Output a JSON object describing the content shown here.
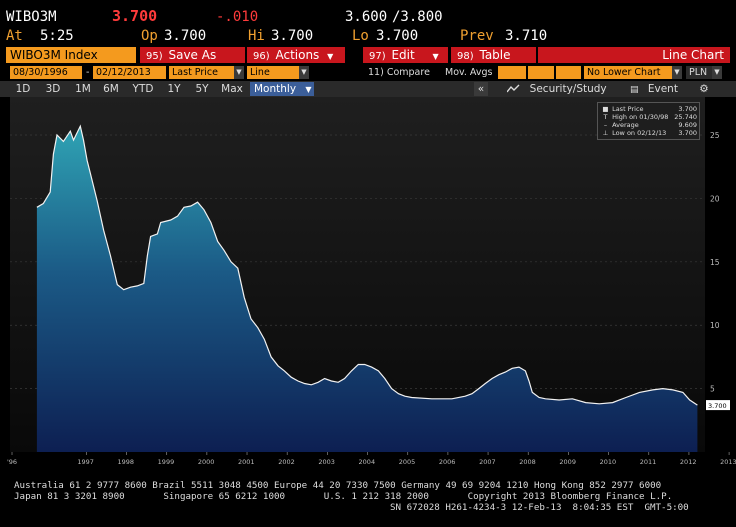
{
  "quote": {
    "ticker": "WIBO3M",
    "last": "3.700",
    "change": "-.010",
    "bid": "3.600",
    "ask": "/3.800",
    "time_label": "At",
    "time": "5:25",
    "open_label": "Op",
    "open": "3.700",
    "high_label": "Hi",
    "high": "3.700",
    "low_label": "Lo",
    "low": "3.700",
    "prev_label": "Prev",
    "prev": "3.710"
  },
  "menu": {
    "security": "WIBO3M Index",
    "save": {
      "num": "95)",
      "label": "Save As"
    },
    "actions": {
      "num": "96)",
      "label": "Actions"
    },
    "edit": {
      "num": "97)",
      "label": "Edit"
    },
    "table": {
      "num": "98)",
      "label": "Table"
    },
    "chart_type": "Line Chart"
  },
  "params": {
    "start_date": "08/30/1996",
    "sep": "-",
    "end_date": "02/12/2013",
    "field": "Last Price",
    "style": "Line",
    "compare": "11) Compare",
    "mov_avgs": "Mov. Avgs",
    "lower_chart": "No Lower Chart",
    "currency": "PLN"
  },
  "toolbar": {
    "periods": [
      "1D",
      "3D",
      "1M",
      "6M",
      "YTD",
      "1Y",
      "5Y",
      "Max"
    ],
    "frequency": "Monthly",
    "security_study": "Security/Study",
    "event": "Event",
    "back": "«"
  },
  "legend": {
    "rows": [
      {
        "label": "Last Price",
        "value": "3.700",
        "icon": "square"
      },
      {
        "label": "High on 01/30/98",
        "value": "25.740",
        "icon": "T"
      },
      {
        "label": "Average",
        "value": "9.609",
        "icon": "dash"
      },
      {
        "label": "Low on 02/12/13",
        "value": "3.700",
        "icon": "L"
      }
    ]
  },
  "chart_data": {
    "type": "area",
    "title": "",
    "xlabel": "",
    "ylabel": "",
    "ylim": [
      0,
      28
    ],
    "x_tick_labels": [
      "'96",
      "1997",
      "1998",
      "1999",
      "2000",
      "2001",
      "2002",
      "2003",
      "2004",
      "2005",
      "2006",
      "2007",
      "2008",
      "2009",
      "2010",
      "2011",
      "2012",
      "2013"
    ],
    "y_ticks": [
      5,
      10,
      15,
      20,
      25
    ],
    "last_value_label": "3.700",
    "series": [
      {
        "points": [
          [
            1996.67,
            19.3
          ],
          [
            1996.83,
            19.6
          ],
          [
            1997.0,
            20.5
          ],
          [
            1997.08,
            23.5
          ],
          [
            1997.17,
            25.0
          ],
          [
            1997.33,
            24.5
          ],
          [
            1997.5,
            25.3
          ],
          [
            1997.58,
            24.6
          ],
          [
            1997.75,
            25.7
          ],
          [
            1997.83,
            24.6
          ],
          [
            1997.92,
            23.0
          ],
          [
            1998.0,
            22.0
          ],
          [
            1998.17,
            19.8
          ],
          [
            1998.33,
            17.5
          ],
          [
            1998.5,
            15.5
          ],
          [
            1998.67,
            13.2
          ],
          [
            1998.83,
            12.8
          ],
          [
            1999.0,
            13.0
          ],
          [
            1999.17,
            13.1
          ],
          [
            1999.33,
            13.3
          ],
          [
            1999.42,
            15.5
          ],
          [
            1999.5,
            17.0
          ],
          [
            1999.67,
            17.2
          ],
          [
            1999.75,
            18.1
          ],
          [
            2000.0,
            18.3
          ],
          [
            2000.17,
            18.6
          ],
          [
            2000.33,
            19.3
          ],
          [
            2000.5,
            19.4
          ],
          [
            2000.67,
            19.7
          ],
          [
            2000.83,
            19.1
          ],
          [
            2001.0,
            18.1
          ],
          [
            2001.17,
            16.6
          ],
          [
            2001.33,
            15.9
          ],
          [
            2001.5,
            15.0
          ],
          [
            2001.67,
            14.5
          ],
          [
            2001.83,
            12.2
          ],
          [
            2002.0,
            10.5
          ],
          [
            2002.17,
            9.8
          ],
          [
            2002.33,
            8.9
          ],
          [
            2002.5,
            7.5
          ],
          [
            2002.67,
            6.8
          ],
          [
            2002.83,
            6.4
          ],
          [
            2003.0,
            5.9
          ],
          [
            2003.17,
            5.6
          ],
          [
            2003.33,
            5.4
          ],
          [
            2003.5,
            5.3
          ],
          [
            2003.67,
            5.5
          ],
          [
            2003.83,
            5.8
          ],
          [
            2004.0,
            5.6
          ],
          [
            2004.17,
            5.5
          ],
          [
            2004.33,
            5.8
          ],
          [
            2004.5,
            6.4
          ],
          [
            2004.67,
            6.9
          ],
          [
            2004.83,
            6.9
          ],
          [
            2005.0,
            6.7
          ],
          [
            2005.17,
            6.4
          ],
          [
            2005.33,
            5.8
          ],
          [
            2005.5,
            5.0
          ],
          [
            2005.67,
            4.6
          ],
          [
            2005.83,
            4.4
          ],
          [
            2006.0,
            4.3
          ],
          [
            2006.5,
            4.2
          ],
          [
            2007.0,
            4.2
          ],
          [
            2007.33,
            4.4
          ],
          [
            2007.5,
            4.6
          ],
          [
            2007.67,
            5.0
          ],
          [
            2007.83,
            5.4
          ],
          [
            2008.0,
            5.8
          ],
          [
            2008.17,
            6.1
          ],
          [
            2008.33,
            6.3
          ],
          [
            2008.5,
            6.6
          ],
          [
            2008.67,
            6.7
          ],
          [
            2008.83,
            6.4
          ],
          [
            2008.92,
            5.6
          ],
          [
            2009.0,
            4.7
          ],
          [
            2009.17,
            4.3
          ],
          [
            2009.33,
            4.2
          ],
          [
            2009.67,
            4.1
          ],
          [
            2010.0,
            4.2
          ],
          [
            2010.33,
            3.9
          ],
          [
            2010.67,
            3.8
          ],
          [
            2011.0,
            3.9
          ],
          [
            2011.33,
            4.3
          ],
          [
            2011.67,
            4.7
          ],
          [
            2012.0,
            4.9
          ],
          [
            2012.25,
            5.0
          ],
          [
            2012.5,
            4.9
          ],
          [
            2012.75,
            4.7
          ],
          [
            2012.92,
            4.1
          ],
          [
            2013.11,
            3.7
          ]
        ]
      }
    ]
  },
  "footer": {
    "line1": "Australia 61 2 9777 8600 Brazil 5511 3048 4500 Europe 44 20 7330 7500 Germany 49 69 9204 1210 Hong Kong 852 2977 6000",
    "line2": "Japan 81 3 3201 8900       Singapore 65 6212 1000       U.S. 1 212 318 2000       Copyright 2013 Bloomberg Finance L.P.",
    "line3": "SN 672028 H261-4234-3 12-Feb-13  8:04:35 EST  GMT-5:00"
  }
}
